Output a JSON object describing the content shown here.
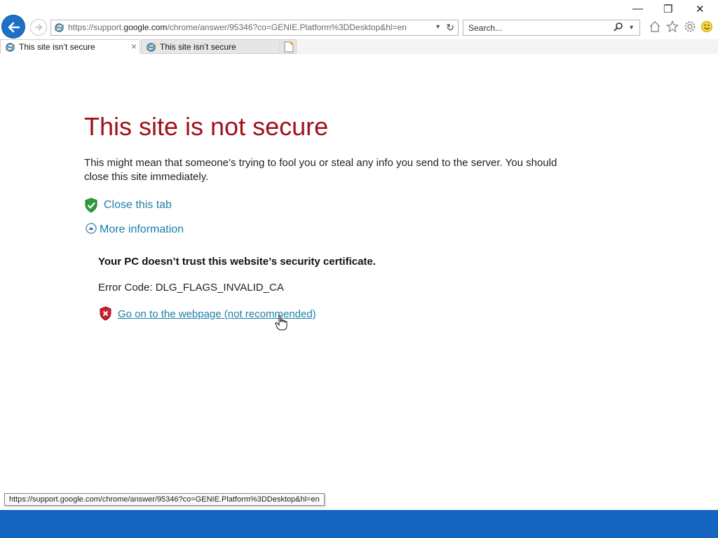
{
  "browser": {
    "address_url_prefix": "https://support.",
    "address_url_domain": "google.com",
    "address_url_rest": "/chrome/answer/95346?co=GENIE.Platform%3DDesktop&hl=en",
    "search_placeholder": "Search...",
    "window_controls": {
      "minimize": "—",
      "restore": "❐",
      "close": "✕"
    },
    "tabs": [
      {
        "label": "This site isn’t secure",
        "active": true,
        "close": "×"
      },
      {
        "label": "This site isn’t secure",
        "active": false
      }
    ]
  },
  "page": {
    "title": "This site is not secure",
    "description": "This might mean that someone’s trying to fool you or steal any info you send to the server. You should close this site immediately.",
    "close_tab_label": "Close this tab",
    "more_info_label": "More information",
    "cert_message": "Your PC doesn’t trust this website’s security certificate.",
    "error_code": "Error Code: DLG_FLAGS_INVALID_CA",
    "go_on_label": "Go on to the webpage (not recommended)"
  },
  "status_bar": {
    "hover_url": "https://support.google.com/chrome/answer/95346?co=GENIE.Platform%3DDesktop&hl=en"
  },
  "colors": {
    "title_red": "#a0101a",
    "link_blue": "#1a7fa8",
    "taskbar_blue": "#1565c0",
    "back_button_blue": "#1e6fc6"
  },
  "icons": {
    "back": "back-arrow-icon",
    "forward": "forward-arrow-icon",
    "site": "ie-logo-icon",
    "refresh": "refresh-icon",
    "search": "magnifier-icon",
    "home": "home-icon",
    "favorites": "star-icon",
    "tools": "gear-icon",
    "feedback": "smiley-icon",
    "close_tab": "green-shield-check-icon",
    "more_info": "collapse-circle-icon",
    "go_on": "red-shield-x-icon"
  }
}
